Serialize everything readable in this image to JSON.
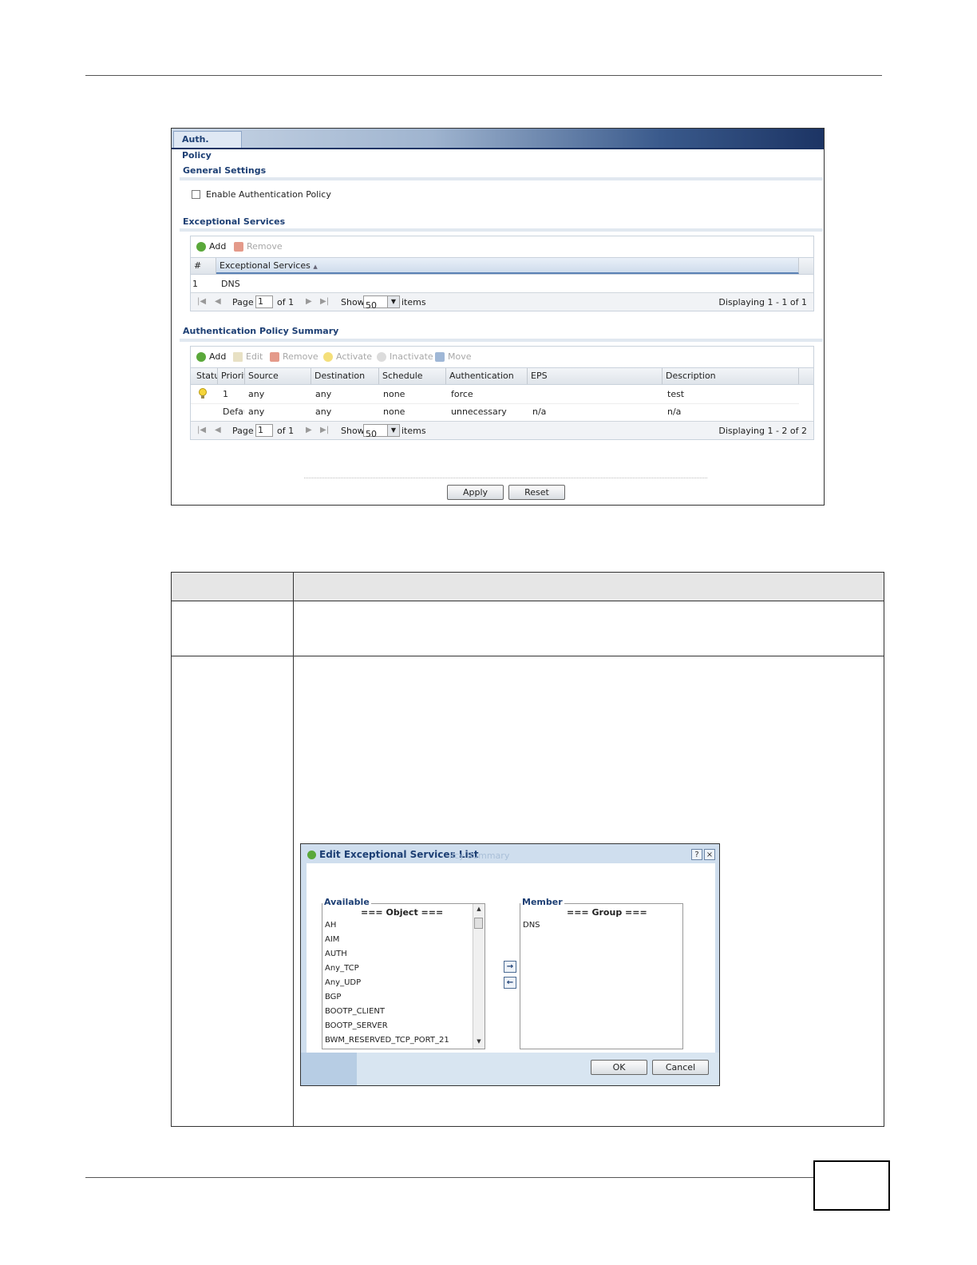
{
  "screenshot": {
    "tab": "Auth. Policy",
    "general": {
      "title": "General Settings",
      "enable_label": "Enable Authentication Policy"
    },
    "exceptional": {
      "title": "Exceptional Services",
      "add": "Add",
      "remove": "Remove",
      "columns": [
        "#",
        "Exceptional Services"
      ],
      "rows": [
        {
          "num": "1",
          "service": "DNS"
        }
      ],
      "pager": {
        "page_label": "Page",
        "page": "1",
        "of": "of 1",
        "show": "Show",
        "per_page": "50",
        "items": "items",
        "displaying": "Displaying 1 - 1 of 1"
      }
    },
    "summary": {
      "title": "Authentication Policy Summary",
      "toolbar": [
        "Add",
        "Edit",
        "Remove",
        "Activate",
        "Inactivate",
        "Move"
      ],
      "columns": [
        "Status",
        "Priority",
        "Source",
        "Destination",
        "Schedule",
        "Authentication",
        "EPS",
        "Description"
      ],
      "rows": [
        {
          "priority": "1",
          "source": "any",
          "destination": "any",
          "schedule": "none",
          "auth": "force",
          "eps": "",
          "description": "test"
        },
        {
          "priority": "Default",
          "source": "any",
          "destination": "any",
          "schedule": "none",
          "auth": "unnecessary",
          "eps": "n/a",
          "description": "n/a"
        }
      ],
      "pager": {
        "page_label": "Page",
        "page": "1",
        "of": "of 1",
        "show": "Show",
        "per_page": "50",
        "items": "items",
        "displaying": "Displaying 1 - 2 of 2"
      }
    },
    "apply": "Apply",
    "reset": "Reset"
  },
  "dialog": {
    "title": "Edit Exceptional Services List",
    "ghost_text": "licy Summary",
    "help": "?",
    "close": "×",
    "available_label": "Available",
    "available_group": "=== Object ===",
    "available_items": [
      "AH",
      "AIM",
      "AUTH",
      "Any_TCP",
      "Any_UDP",
      "BGP",
      "BOOTP_CLIENT",
      "BOOTP_SERVER",
      "BWM_RESERVED_TCP_PORT_21"
    ],
    "member_label": "Member",
    "member_group": "=== Group ===",
    "member_items": [
      "DNS"
    ],
    "ok": "OK",
    "cancel": "Cancel"
  }
}
